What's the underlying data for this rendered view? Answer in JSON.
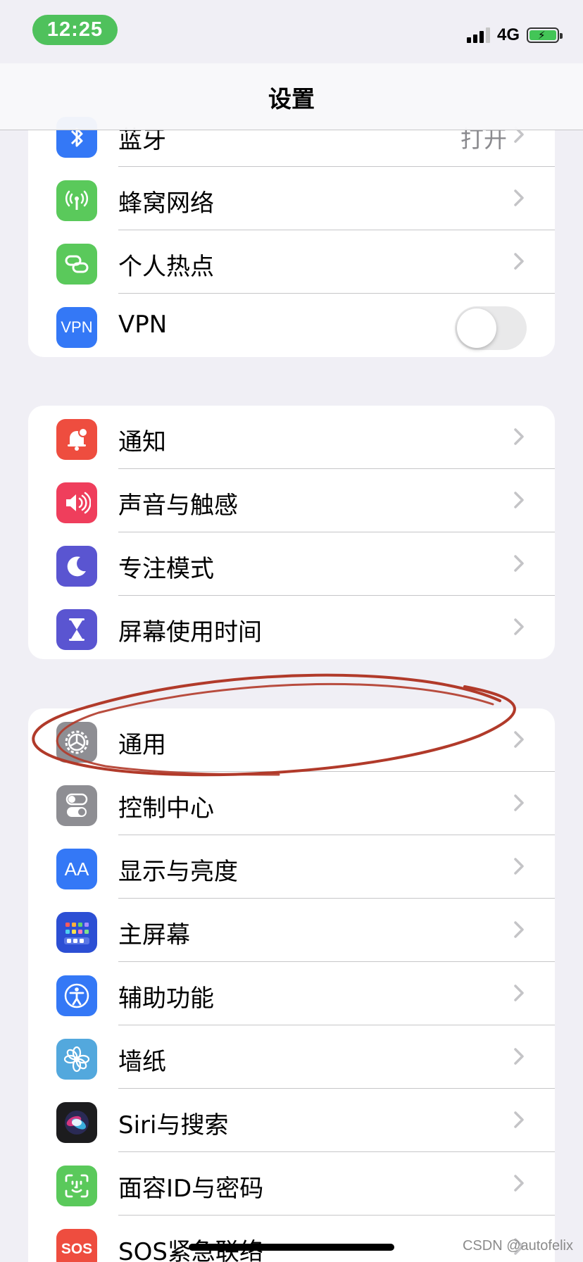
{
  "status_bar": {
    "time": "12:25",
    "network": "4G",
    "battery_charging": true
  },
  "nav": {
    "title": "设置"
  },
  "groups": [
    {
      "rows": [
        {
          "label": "蓝牙",
          "value": "打开",
          "icon": "bluetooth-icon",
          "color": "#3478f6"
        },
        {
          "label": "蜂窝网络",
          "icon": "antenna-icon",
          "color": "#5ac95b"
        },
        {
          "label": "个人热点",
          "icon": "link-icon",
          "color": "#5ac95b"
        },
        {
          "label": "VPN",
          "icon_text": "VPN",
          "icon": "vpn-icon",
          "color": "#3478f6",
          "toggle": false
        }
      ]
    },
    {
      "rows": [
        {
          "label": "通知",
          "icon": "bell-icon",
          "color": "#ee4d3f"
        },
        {
          "label": "声音与触感",
          "icon": "speaker-icon",
          "color": "#ef3e5c"
        },
        {
          "label": "专注模式",
          "icon": "moon-icon",
          "color": "#5a55d1"
        },
        {
          "label": "屏幕使用时间",
          "icon": "hourglass-icon",
          "color": "#5a55d1"
        }
      ]
    },
    {
      "rows": [
        {
          "label": "通用",
          "icon": "gear-icon",
          "color": "#8e8e93"
        },
        {
          "label": "控制中心",
          "icon": "switches-icon",
          "color": "#8e8e93"
        },
        {
          "label": "显示与亮度",
          "icon_text": "AA",
          "icon": "text-size-icon",
          "color": "#3478f6"
        },
        {
          "label": "主屏幕",
          "icon": "home-screen-icon",
          "color": "#2c4fd4"
        },
        {
          "label": "辅助功能",
          "icon": "accessibility-icon",
          "color": "#3478f6"
        },
        {
          "label": "墙纸",
          "icon": "flower-icon",
          "color": "#53a8dd"
        },
        {
          "label": "Siri与搜索",
          "icon": "siri-icon",
          "color": "#1c1c1e"
        },
        {
          "label": "面容ID与密码",
          "icon": "face-id-icon",
          "color": "#5ac95b"
        },
        {
          "label": "SOS紧急联络",
          "icon_text": "SOS",
          "icon": "sos-icon",
          "color": "#ee4d3f"
        }
      ]
    }
  ],
  "annotation": {
    "shape": "hand-drawn-ellipse",
    "color": "#b13a2a",
    "target": "通用"
  },
  "watermark": "CSDN @autofelix"
}
